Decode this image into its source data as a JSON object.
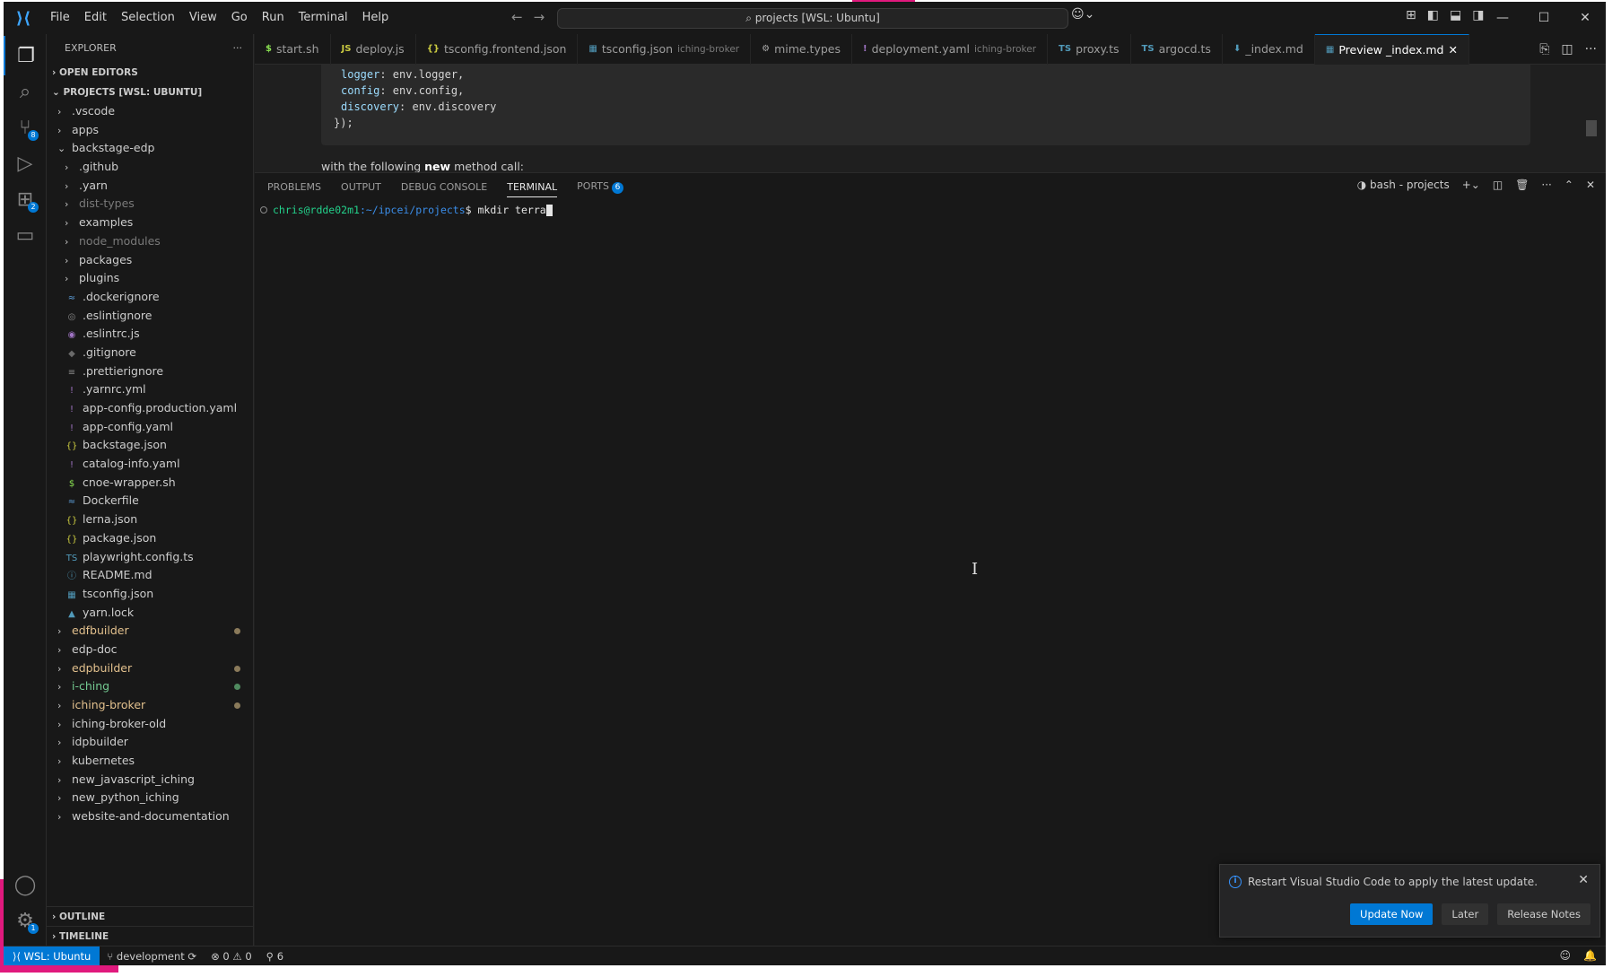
{
  "titlebar": {
    "menu": [
      "File",
      "Edit",
      "Selection",
      "View",
      "Go",
      "Run",
      "Terminal",
      "Help"
    ],
    "search": "projects [WSL: Ubuntu]",
    "copilot_icon": "copilot-icon",
    "controls": {
      "minimize": "—",
      "maximize": "☐",
      "close": "✕"
    }
  },
  "activitybar": {
    "items": [
      {
        "name": "explorer-icon",
        "glyph": "❐",
        "active": true
      },
      {
        "name": "search-icon",
        "glyph": "⌕"
      },
      {
        "name": "source-control-icon",
        "glyph": "⑂",
        "badge": "8"
      },
      {
        "name": "run-debug-icon",
        "glyph": "▷"
      },
      {
        "name": "extensions-icon",
        "glyph": "⊞",
        "badge": "2"
      },
      {
        "name": "remote-explorer-icon",
        "glyph": "▭"
      }
    ],
    "bottom": [
      {
        "name": "account-icon",
        "glyph": "◯"
      },
      {
        "name": "settings-gear-icon",
        "glyph": "⚙",
        "badge": "1"
      }
    ]
  },
  "sidebar": {
    "title": "EXPLORER",
    "more": "···",
    "open_editors": "OPEN EDITORS",
    "projects": "PROJECTS [WSL: UBUNTU]",
    "tree": [
      {
        "label": ".vscode",
        "type": "folder",
        "indent": 1
      },
      {
        "label": "apps",
        "type": "folder",
        "indent": 1
      },
      {
        "label": "backstage-edp",
        "type": "folder-open",
        "indent": 1
      },
      {
        "label": ".github",
        "type": "folder",
        "indent": 2
      },
      {
        "label": ".yarn",
        "type": "folder",
        "indent": 2
      },
      {
        "label": "dist-types",
        "type": "folder",
        "indent": 2,
        "dim": true
      },
      {
        "label": "examples",
        "type": "folder",
        "indent": 2
      },
      {
        "label": "node_modules",
        "type": "folder",
        "indent": 2,
        "dim": true
      },
      {
        "label": "packages",
        "type": "folder",
        "indent": 2
      },
      {
        "label": "plugins",
        "type": "folder",
        "indent": 2
      },
      {
        "label": ".dockerignore",
        "type": "file",
        "icon": "≈",
        "color": "#5b9bd5",
        "indent": 2
      },
      {
        "label": ".eslintignore",
        "type": "file",
        "icon": "◎",
        "color": "#8a8a8a",
        "indent": 2
      },
      {
        "label": ".eslintrc.js",
        "type": "file",
        "icon": "◉",
        "color": "#a074c4",
        "indent": 2
      },
      {
        "label": ".gitignore",
        "type": "file",
        "icon": "◆",
        "color": "#6a6a6a",
        "indent": 2
      },
      {
        "label": ".prettierignore",
        "type": "file",
        "icon": "≡",
        "color": "#8a8a8a",
        "indent": 2
      },
      {
        "label": ".yarnrc.yml",
        "type": "file",
        "icon": "!",
        "color": "#a074c4",
        "indent": 2
      },
      {
        "label": "app-config.production.yaml",
        "type": "file",
        "icon": "!",
        "color": "#a074c4",
        "indent": 2
      },
      {
        "label": "app-config.yaml",
        "type": "file",
        "icon": "!",
        "color": "#a074c4",
        "indent": 2
      },
      {
        "label": "backstage.json",
        "type": "file",
        "icon": "{}",
        "color": "#cbcb41",
        "indent": 2
      },
      {
        "label": "catalog-info.yaml",
        "type": "file",
        "icon": "!",
        "color": "#a074c4",
        "indent": 2
      },
      {
        "label": "cnoe-wrapper.sh",
        "type": "file",
        "icon": "$",
        "color": "#89e051",
        "indent": 2
      },
      {
        "label": "Dockerfile",
        "type": "file",
        "icon": "≈",
        "color": "#5b9bd5",
        "indent": 2
      },
      {
        "label": "lerna.json",
        "type": "file",
        "icon": "{}",
        "color": "#cbcb41",
        "indent": 2
      },
      {
        "label": "package.json",
        "type": "file",
        "icon": "{}",
        "color": "#cbcb41",
        "indent": 2
      },
      {
        "label": "playwright.config.ts",
        "type": "file",
        "icon": "TS",
        "color": "#519aba",
        "indent": 2
      },
      {
        "label": "README.md",
        "type": "file",
        "icon": "ⓘ",
        "color": "#519aba",
        "indent": 2
      },
      {
        "label": "tsconfig.json",
        "type": "file",
        "icon": "▦",
        "color": "#519aba",
        "indent": 2
      },
      {
        "label": "yarn.lock",
        "type": "file",
        "icon": "▲",
        "color": "#519aba",
        "indent": 2
      },
      {
        "label": "edfbuilder",
        "type": "folder",
        "indent": 1,
        "color": "#e2c08d",
        "dot": "#8a7a5a"
      },
      {
        "label": "edp-doc",
        "type": "folder",
        "indent": 1
      },
      {
        "label": "edpbuilder",
        "type": "folder",
        "indent": 1,
        "color": "#e2c08d",
        "dot": "#8a7a5a"
      },
      {
        "label": "i-ching",
        "type": "folder",
        "indent": 1,
        "color": "#73c991",
        "dot": "#4f8a5f"
      },
      {
        "label": "iching-broker",
        "type": "folder",
        "indent": 1,
        "color": "#e2c08d",
        "dot": "#8a7a5a"
      },
      {
        "label": "iching-broker-old",
        "type": "folder",
        "indent": 1
      },
      {
        "label": "idpbuilder",
        "type": "folder",
        "indent": 1
      },
      {
        "label": "kubernetes",
        "type": "folder",
        "indent": 1
      },
      {
        "label": "new_javascript_iching",
        "type": "folder",
        "indent": 1
      },
      {
        "label": "new_python_iching",
        "type": "folder",
        "indent": 1
      },
      {
        "label": "website-and-documentation",
        "type": "folder",
        "indent": 1
      }
    ],
    "outline": "OUTLINE",
    "timeline": "TIMELINE"
  },
  "tabs": [
    {
      "label": "start.sh",
      "icon": "$",
      "color": "#89e051"
    },
    {
      "label": "deploy.js",
      "icon": "JS",
      "color": "#cbcb41"
    },
    {
      "label": "tsconfig.frontend.json",
      "icon": "{}",
      "color": "#cbcb41"
    },
    {
      "label": "tsconfig.json",
      "icon": "▦",
      "color": "#519aba",
      "desc": "iching-broker"
    },
    {
      "label": "mime.types",
      "icon": "⚙",
      "color": "#aaaaaa"
    },
    {
      "label": "deployment.yaml",
      "icon": "!",
      "color": "#a074c4",
      "desc": "iching-broker"
    },
    {
      "label": "proxy.ts",
      "icon": "TS",
      "color": "#519aba"
    },
    {
      "label": "argocd.ts",
      "icon": "TS",
      "color": "#519aba"
    },
    {
      "label": "_index.md",
      "icon": "⬇",
      "color": "#519aba"
    },
    {
      "label": "Preview _index.md",
      "icon": "▦",
      "color": "#519aba",
      "active": true,
      "close": "✕"
    }
  ],
  "editor": {
    "code": [
      {
        "key": "logger",
        "rest": ": env.logger,"
      },
      {
        "key": "config",
        "rest": ": env.config,"
      },
      {
        "key": "discovery",
        "rest": ": env.discovery"
      },
      {
        "key": "",
        "rest": "});"
      }
    ],
    "prose_before": "with the following ",
    "prose_bold": "new",
    "prose_after": " method call:"
  },
  "panel": {
    "tabs": [
      "PROBLEMS",
      "OUTPUT",
      "DEBUG CONSOLE",
      "TERMINAL",
      "PORTS"
    ],
    "active_tab": "TERMINAL",
    "ports_count": "6",
    "terminal_name": "bash - projects",
    "prompt_user": "chris@rdde02m1",
    "prompt_path": ":~/ipcei/projects",
    "prompt_symbol": "$",
    "command": " mkdir terra"
  },
  "notification": {
    "message": "Restart Visual Studio Code to apply the latest update.",
    "buttons": [
      "Update Now",
      "Later",
      "Release Notes"
    ]
  },
  "statusbar": {
    "remote": "WSL: Ubuntu",
    "branch": "development",
    "errors": "0",
    "warnings": "0",
    "ports": "6"
  },
  "colors": {
    "accent": "#0078d4",
    "highlight": "#e0197d"
  }
}
